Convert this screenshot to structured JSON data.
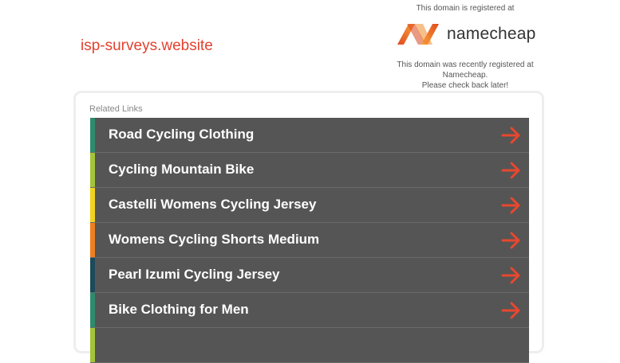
{
  "header": {
    "domain": "isp-surveys.website",
    "registered_top": "This domain is registered at",
    "brand_name": "namecheap",
    "registered_note_line1": "This domain was recently registered at Namecheap.",
    "registered_note_line2": "Please check back later!"
  },
  "related": {
    "title": "Related Links",
    "links": [
      {
        "label": "Road Cycling Clothing",
        "color": "#2e8b6e"
      },
      {
        "label": "Cycling Mountain Bike",
        "color": "#a2c43a"
      },
      {
        "label": "Castelli Womens Cycling Jersey",
        "color": "#f2d31b"
      },
      {
        "label": "Womens Cycling Shorts Medium",
        "color": "#f07f22"
      },
      {
        "label": "Pearl Izumi Cycling Jersey",
        "color": "#1c4a5a"
      },
      {
        "label": "Bike Clothing for Men",
        "color": "#2e8b6e"
      },
      {
        "label": "",
        "color": "#a2c43a"
      }
    ]
  },
  "colors": {
    "accent": "#e2422f",
    "row_bg": "#555555",
    "arrow": "#e8472f",
    "logo_orange_dark": "#e04a1f",
    "logo_orange_light": "#f9a23a"
  },
  "icons": {
    "logo": "namecheap-logo-icon",
    "row_arrow": "arrow-right-icon"
  }
}
